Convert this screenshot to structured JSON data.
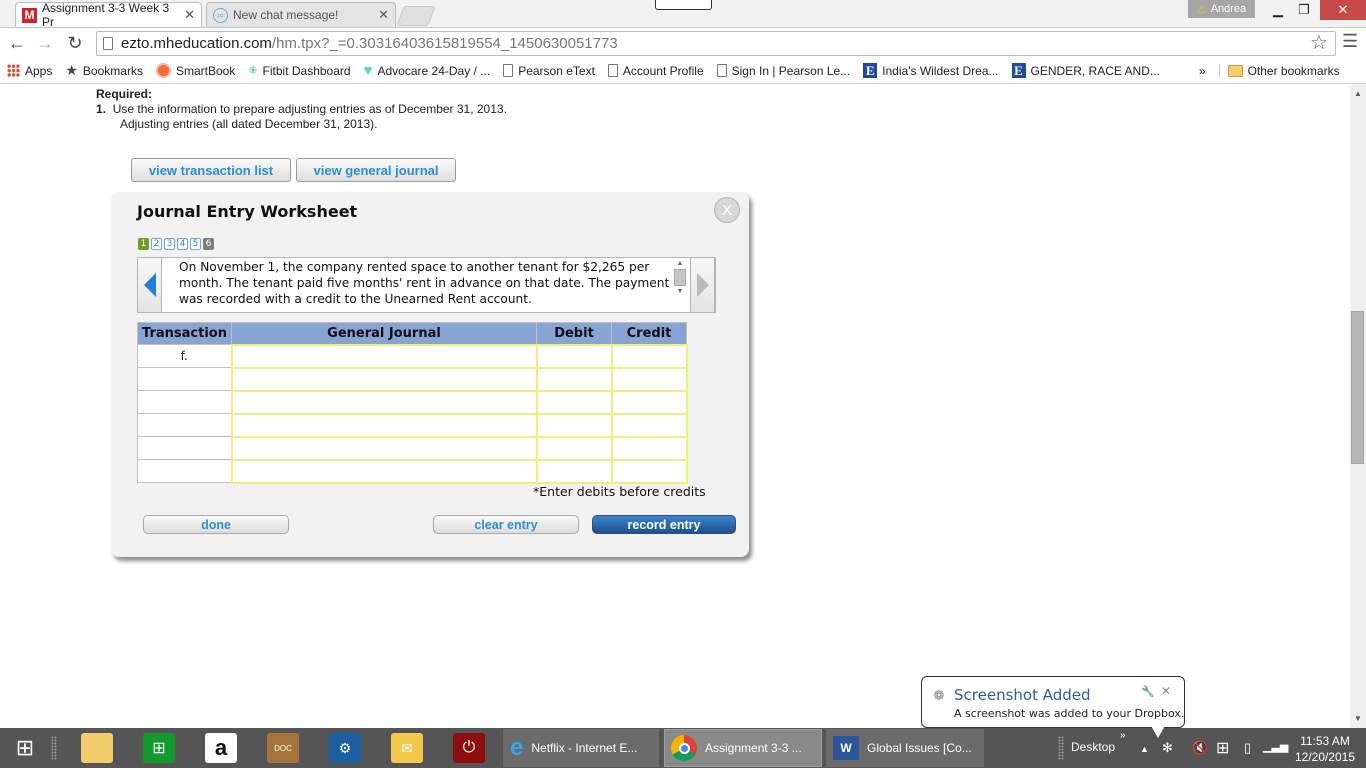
{
  "browser": {
    "tabs": [
      {
        "title": "Assignment 3-3 Week 3 Pr",
        "active": true,
        "favicon": "mheducation-m"
      },
      {
        "title": "New chat message!",
        "active": false,
        "favicon": "chat-icon"
      }
    ],
    "profile_name": "Andrea",
    "url_host": "ezto.mheducation.com",
    "url_path": "/hm.tpx?_=0.30316403615819554_1450630051773",
    "bookmarks": [
      {
        "label": "Apps",
        "icon": "apps-grid-icon"
      },
      {
        "label": "Bookmarks",
        "icon": "star-icon"
      },
      {
        "label": "SmartBook",
        "icon": "smartbook-icon"
      },
      {
        "label": "Fitbit Dashboard",
        "icon": "fitbit-icon"
      },
      {
        "label": "Advocare 24-Day / ...",
        "icon": "heart-icon"
      },
      {
        "label": "Pearson eText",
        "icon": "page-icon"
      },
      {
        "label": "Account Profile",
        "icon": "page-icon"
      },
      {
        "label": "Sign In | Pearson Le...",
        "icon": "page-icon"
      },
      {
        "label": "India's Wildest Drea...",
        "icon": "e-icon"
      },
      {
        "label": "GENDER, RACE AND...",
        "icon": "e-icon"
      }
    ],
    "bookmarks_overflow": "»",
    "other_bookmarks": "Other bookmarks"
  },
  "page": {
    "required_heading": "Required:",
    "item_number": "1.",
    "item_text": "Use the information to prepare adjusting entries as of December 31, 2013.",
    "item_subtext": "Adjusting entries (all dated December 31, 2013).",
    "view_transaction_list": "view transaction list",
    "view_general_journal": "view general journal"
  },
  "worksheet": {
    "title": "Journal Entry Worksheet",
    "close_label": "X",
    "pages": [
      "1",
      "2",
      "3",
      "4",
      "5",
      "6"
    ],
    "current_page": 1,
    "description": "On November 1, the company rented space to another tenant for $2,265 per month. The tenant paid five months' rent in advance on that date. The payment was recorded with a credit to the Unearned Rent account.",
    "columns": [
      "Transaction",
      "General Journal",
      "Debit",
      "Credit"
    ],
    "rows": [
      {
        "transaction": "f.",
        "account": "",
        "debit": "",
        "credit": ""
      },
      {
        "transaction": "",
        "account": "",
        "debit": "",
        "credit": ""
      },
      {
        "transaction": "",
        "account": "",
        "debit": "",
        "credit": ""
      },
      {
        "transaction": "",
        "account": "",
        "debit": "",
        "credit": ""
      },
      {
        "transaction": "",
        "account": "",
        "debit": "",
        "credit": ""
      },
      {
        "transaction": "",
        "account": "",
        "debit": "",
        "credit": ""
      }
    ],
    "note": "*Enter debits before credits",
    "done": "done",
    "clear_entry": "clear entry",
    "record_entry": "record entry"
  },
  "toast": {
    "title": "Screenshot Added",
    "body": "A screenshot was added to your Dropbox."
  },
  "taskbar": {
    "pinned": [
      "start",
      "file-explorer",
      "store",
      "amazon",
      "doc-app",
      "settings-app",
      "outlook",
      "power-app"
    ],
    "tasks": [
      {
        "label": "Netflix - Internet E...",
        "icon": "internet-explorer-icon",
        "active": false
      },
      {
        "label": "Assignment 3-3 ...",
        "icon": "chrome-icon",
        "active": true
      },
      {
        "label": "Global Issues [Co...",
        "icon": "word-icon",
        "active": false
      }
    ],
    "desktop_label": "Desktop",
    "time": "11:53 AM",
    "date": "12/20/2015"
  }
}
